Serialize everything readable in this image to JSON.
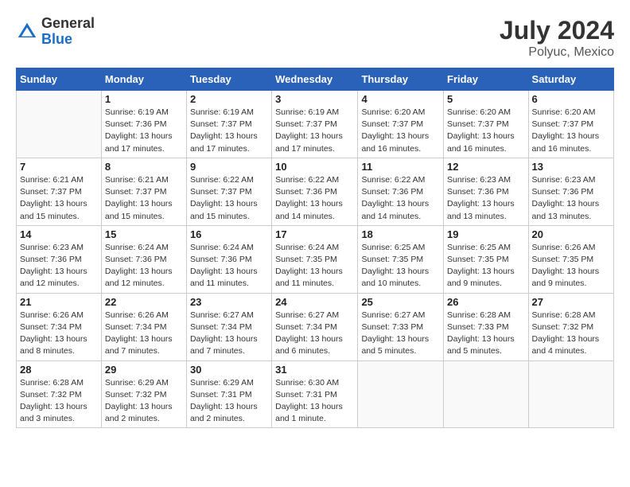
{
  "header": {
    "logo_general": "General",
    "logo_blue": "Blue",
    "month_year": "July 2024",
    "location": "Polyuc, Mexico"
  },
  "days_of_week": [
    "Sunday",
    "Monday",
    "Tuesday",
    "Wednesday",
    "Thursday",
    "Friday",
    "Saturday"
  ],
  "weeks": [
    [
      {
        "day": "",
        "sunrise": "",
        "sunset": "",
        "daylight": ""
      },
      {
        "day": "1",
        "sunrise": "Sunrise: 6:19 AM",
        "sunset": "Sunset: 7:36 PM",
        "daylight": "Daylight: 13 hours and 17 minutes."
      },
      {
        "day": "2",
        "sunrise": "Sunrise: 6:19 AM",
        "sunset": "Sunset: 7:37 PM",
        "daylight": "Daylight: 13 hours and 17 minutes."
      },
      {
        "day": "3",
        "sunrise": "Sunrise: 6:19 AM",
        "sunset": "Sunset: 7:37 PM",
        "daylight": "Daylight: 13 hours and 17 minutes."
      },
      {
        "day": "4",
        "sunrise": "Sunrise: 6:20 AM",
        "sunset": "Sunset: 7:37 PM",
        "daylight": "Daylight: 13 hours and 16 minutes."
      },
      {
        "day": "5",
        "sunrise": "Sunrise: 6:20 AM",
        "sunset": "Sunset: 7:37 PM",
        "daylight": "Daylight: 13 hours and 16 minutes."
      },
      {
        "day": "6",
        "sunrise": "Sunrise: 6:20 AM",
        "sunset": "Sunset: 7:37 PM",
        "daylight": "Daylight: 13 hours and 16 minutes."
      }
    ],
    [
      {
        "day": "7",
        "sunrise": "Sunrise: 6:21 AM",
        "sunset": "Sunset: 7:37 PM",
        "daylight": "Daylight: 13 hours and 15 minutes."
      },
      {
        "day": "8",
        "sunrise": "Sunrise: 6:21 AM",
        "sunset": "Sunset: 7:37 PM",
        "daylight": "Daylight: 13 hours and 15 minutes."
      },
      {
        "day": "9",
        "sunrise": "Sunrise: 6:22 AM",
        "sunset": "Sunset: 7:37 PM",
        "daylight": "Daylight: 13 hours and 15 minutes."
      },
      {
        "day": "10",
        "sunrise": "Sunrise: 6:22 AM",
        "sunset": "Sunset: 7:36 PM",
        "daylight": "Daylight: 13 hours and 14 minutes."
      },
      {
        "day": "11",
        "sunrise": "Sunrise: 6:22 AM",
        "sunset": "Sunset: 7:36 PM",
        "daylight": "Daylight: 13 hours and 14 minutes."
      },
      {
        "day": "12",
        "sunrise": "Sunrise: 6:23 AM",
        "sunset": "Sunset: 7:36 PM",
        "daylight": "Daylight: 13 hours and 13 minutes."
      },
      {
        "day": "13",
        "sunrise": "Sunrise: 6:23 AM",
        "sunset": "Sunset: 7:36 PM",
        "daylight": "Daylight: 13 hours and 13 minutes."
      }
    ],
    [
      {
        "day": "14",
        "sunrise": "Sunrise: 6:23 AM",
        "sunset": "Sunset: 7:36 PM",
        "daylight": "Daylight: 13 hours and 12 minutes."
      },
      {
        "day": "15",
        "sunrise": "Sunrise: 6:24 AM",
        "sunset": "Sunset: 7:36 PM",
        "daylight": "Daylight: 13 hours and 12 minutes."
      },
      {
        "day": "16",
        "sunrise": "Sunrise: 6:24 AM",
        "sunset": "Sunset: 7:36 PM",
        "daylight": "Daylight: 13 hours and 11 minutes."
      },
      {
        "day": "17",
        "sunrise": "Sunrise: 6:24 AM",
        "sunset": "Sunset: 7:35 PM",
        "daylight": "Daylight: 13 hours and 11 minutes."
      },
      {
        "day": "18",
        "sunrise": "Sunrise: 6:25 AM",
        "sunset": "Sunset: 7:35 PM",
        "daylight": "Daylight: 13 hours and 10 minutes."
      },
      {
        "day": "19",
        "sunrise": "Sunrise: 6:25 AM",
        "sunset": "Sunset: 7:35 PM",
        "daylight": "Daylight: 13 hours and 9 minutes."
      },
      {
        "day": "20",
        "sunrise": "Sunrise: 6:26 AM",
        "sunset": "Sunset: 7:35 PM",
        "daylight": "Daylight: 13 hours and 9 minutes."
      }
    ],
    [
      {
        "day": "21",
        "sunrise": "Sunrise: 6:26 AM",
        "sunset": "Sunset: 7:34 PM",
        "daylight": "Daylight: 13 hours and 8 minutes."
      },
      {
        "day": "22",
        "sunrise": "Sunrise: 6:26 AM",
        "sunset": "Sunset: 7:34 PM",
        "daylight": "Daylight: 13 hours and 7 minutes."
      },
      {
        "day": "23",
        "sunrise": "Sunrise: 6:27 AM",
        "sunset": "Sunset: 7:34 PM",
        "daylight": "Daylight: 13 hours and 7 minutes."
      },
      {
        "day": "24",
        "sunrise": "Sunrise: 6:27 AM",
        "sunset": "Sunset: 7:34 PM",
        "daylight": "Daylight: 13 hours and 6 minutes."
      },
      {
        "day": "25",
        "sunrise": "Sunrise: 6:27 AM",
        "sunset": "Sunset: 7:33 PM",
        "daylight": "Daylight: 13 hours and 5 minutes."
      },
      {
        "day": "26",
        "sunrise": "Sunrise: 6:28 AM",
        "sunset": "Sunset: 7:33 PM",
        "daylight": "Daylight: 13 hours and 5 minutes."
      },
      {
        "day": "27",
        "sunrise": "Sunrise: 6:28 AM",
        "sunset": "Sunset: 7:32 PM",
        "daylight": "Daylight: 13 hours and 4 minutes."
      }
    ],
    [
      {
        "day": "28",
        "sunrise": "Sunrise: 6:28 AM",
        "sunset": "Sunset: 7:32 PM",
        "daylight": "Daylight: 13 hours and 3 minutes."
      },
      {
        "day": "29",
        "sunrise": "Sunrise: 6:29 AM",
        "sunset": "Sunset: 7:32 PM",
        "daylight": "Daylight: 13 hours and 2 minutes."
      },
      {
        "day": "30",
        "sunrise": "Sunrise: 6:29 AM",
        "sunset": "Sunset: 7:31 PM",
        "daylight": "Daylight: 13 hours and 2 minutes."
      },
      {
        "day": "31",
        "sunrise": "Sunrise: 6:30 AM",
        "sunset": "Sunset: 7:31 PM",
        "daylight": "Daylight: 13 hours and 1 minute."
      },
      {
        "day": "",
        "sunrise": "",
        "sunset": "",
        "daylight": ""
      },
      {
        "day": "",
        "sunrise": "",
        "sunset": "",
        "daylight": ""
      },
      {
        "day": "",
        "sunrise": "",
        "sunset": "",
        "daylight": ""
      }
    ]
  ]
}
